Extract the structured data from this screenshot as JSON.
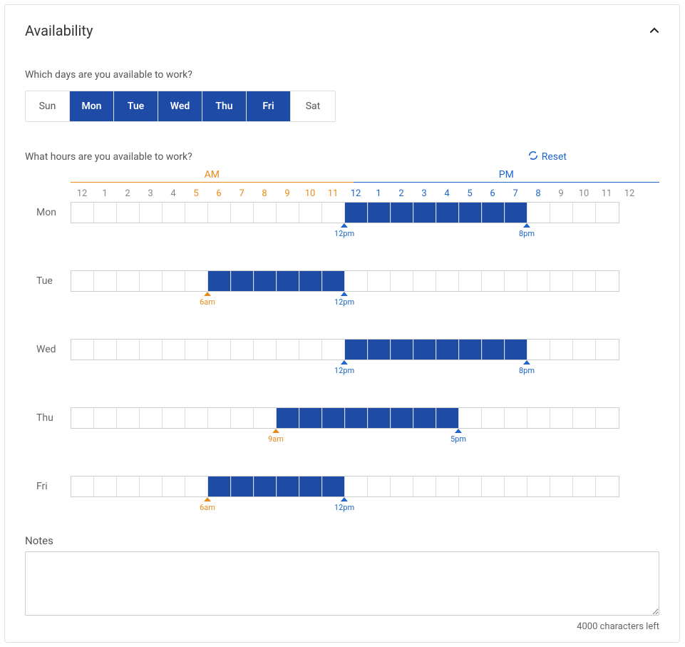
{
  "panel": {
    "title": "Availability",
    "days_question": "Which days are you available to work?",
    "hours_question": "What hours are you available to work?",
    "reset_label": "Reset",
    "am_label": "AM",
    "pm_label": "PM",
    "notes_label": "Notes",
    "char_count": "4000 characters left",
    "notes_value": ""
  },
  "days": [
    {
      "label": "Sun",
      "selected": false
    },
    {
      "label": "Mon",
      "selected": true
    },
    {
      "label": "Tue",
      "selected": true
    },
    {
      "label": "Wed",
      "selected": true
    },
    {
      "label": "Thu",
      "selected": true
    },
    {
      "label": "Fri",
      "selected": true
    },
    {
      "label": "Sat",
      "selected": false
    }
  ],
  "hour_labels": [
    "12",
    "1",
    "2",
    "3",
    "4",
    "5",
    "6",
    "7",
    "8",
    "9",
    "10",
    "11",
    "12",
    "1",
    "2",
    "3",
    "4",
    "5",
    "6",
    "7",
    "8",
    "9",
    "10",
    "11",
    "12"
  ],
  "active_hour_min_idx": 5,
  "active_hour_max_idx": 20,
  "schedule": [
    {
      "day": "Mon",
      "start_idx": 12,
      "end_idx": 20,
      "start_label": "12pm",
      "start_period": "pm",
      "end_label": "8pm",
      "end_period": "pm"
    },
    {
      "day": "Tue",
      "start_idx": 6,
      "end_idx": 12,
      "start_label": "6am",
      "start_period": "am",
      "end_label": "12pm",
      "end_period": "pm"
    },
    {
      "day": "Wed",
      "start_idx": 12,
      "end_idx": 20,
      "start_label": "12pm",
      "start_period": "pm",
      "end_label": "8pm",
      "end_period": "pm"
    },
    {
      "day": "Thu",
      "start_idx": 9,
      "end_idx": 17,
      "start_label": "9am",
      "start_period": "am",
      "end_label": "5pm",
      "end_period": "pm"
    },
    {
      "day": "Fri",
      "start_idx": 6,
      "end_idx": 12,
      "start_label": "6am",
      "start_period": "am",
      "end_label": "12pm",
      "end_period": "pm"
    }
  ]
}
